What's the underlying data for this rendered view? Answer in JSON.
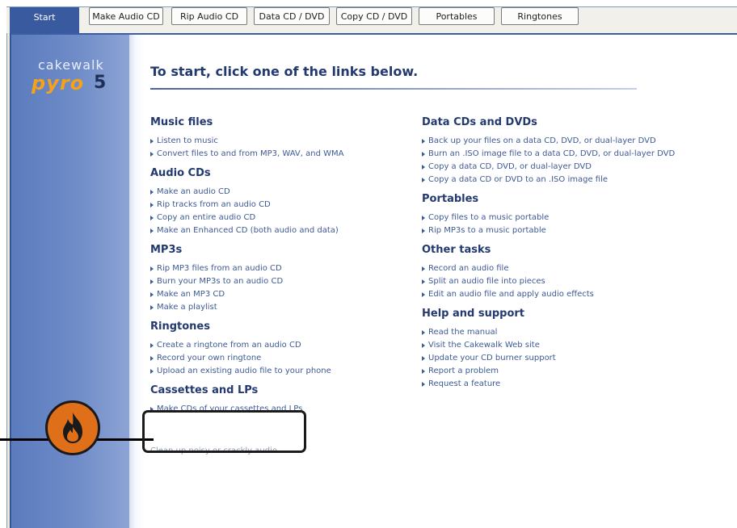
{
  "tabs": [
    {
      "label": "Start"
    },
    {
      "label": "Make Audio CD"
    },
    {
      "label": "Rip Audio CD"
    },
    {
      "label": "Data CD / DVD"
    },
    {
      "label": "Copy CD / DVD"
    },
    {
      "label": "Portables"
    },
    {
      "label": "Ringtones"
    }
  ],
  "brand": {
    "company": "cakewalk",
    "product": "pyro",
    "version": "5"
  },
  "headline": "To start, click one of the links below.",
  "left_sections": [
    {
      "title": "Music files",
      "links": [
        "Listen to music",
        "Convert files to and from MP3, WAV, and WMA"
      ]
    },
    {
      "title": "Audio CDs",
      "links": [
        "Make an audio CD",
        "Rip tracks from an audio CD",
        "Copy an entire audio CD",
        "Make an Enhanced CD (both audio and data)"
      ]
    },
    {
      "title": "MP3s",
      "links": [
        "Rip MP3 files from an audio CD",
        "Burn your MP3s to an audio CD",
        "Make an MP3 CD",
        "Make a playlist"
      ]
    },
    {
      "title": "Ringtones",
      "links": [
        "Create a ringtone from an audio CD",
        "Record your own ringtone",
        "Upload an existing audio file to your phone"
      ]
    },
    {
      "title": "Cassettes and LPs",
      "links": [
        "Make CDs of your cassettes and LPs"
      ]
    }
  ],
  "right_sections": [
    {
      "title": "Data CDs and DVDs",
      "links": [
        "Back up your files on a data CD, DVD, or dual-layer DVD",
        "Burn an .ISO image file to a data CD, DVD, or dual-layer DVD",
        "Copy a data CD, DVD, or dual-layer DVD",
        "Copy a data CD or DVD to an .ISO image file"
      ]
    },
    {
      "title": "Portables",
      "links": [
        "Copy files to a music portable",
        "Rip MP3s to a music portable"
      ]
    },
    {
      "title": "Other tasks",
      "links": [
        "Record an audio file",
        "Split an audio file into pieces",
        "Edit an audio file and apply audio effects"
      ]
    },
    {
      "title": "Help and support",
      "links": [
        "Read the manual",
        "Visit the Cakewalk Web site",
        "Update your CD burner support",
        "Report a problem",
        "Request a feature"
      ]
    }
  ],
  "clipped_link": "Clean up noisy or crackly audio",
  "colors": {
    "accent": "#3a5aa0",
    "link": "#3e5a94",
    "heading": "#233a70",
    "callout": "#e06f1a"
  },
  "icons": {
    "callout": "flame-icon",
    "bullet": "arrow-right-icon"
  }
}
